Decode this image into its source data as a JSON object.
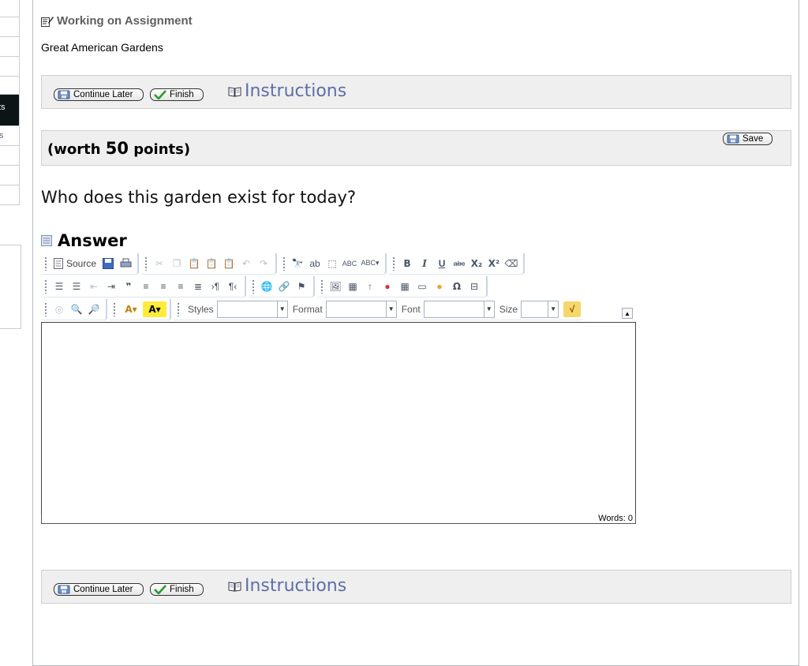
{
  "sidebar": {
    "items": [
      {
        "label": ""
      },
      {
        "label": ""
      },
      {
        "label": ""
      },
      {
        "label": ""
      },
      {
        "label": ""
      },
      {
        "label": "ts",
        "active": true
      },
      {
        "label": "s"
      },
      {
        "label": ""
      },
      {
        "label": ""
      },
      {
        "label": ""
      }
    ]
  },
  "header": {
    "title": "Working on Assignment",
    "assignment_name": "Great American Gardens"
  },
  "actions": {
    "continue_later": "Continue Later",
    "finish": "Finish",
    "instructions": "Instructions",
    "save": "Save"
  },
  "question": {
    "worth_prefix": "(worth ",
    "points": "50",
    "worth_suffix": " points)",
    "text": "Who does this garden exist for today?"
  },
  "answer": {
    "heading": "Answer",
    "editor": {
      "source_label": "Source",
      "styles_label": "Styles",
      "format_label": "Format",
      "font_label": "Font",
      "size_label": "Size",
      "styles_value": "",
      "format_value": "",
      "font_value": "",
      "size_value": "",
      "content": "",
      "word_count": "Words: 0"
    }
  },
  "colors": {
    "accent_link": "#5f6ea8",
    "bar_bg": "#efefef",
    "active_sidebar": "#0d1416"
  }
}
